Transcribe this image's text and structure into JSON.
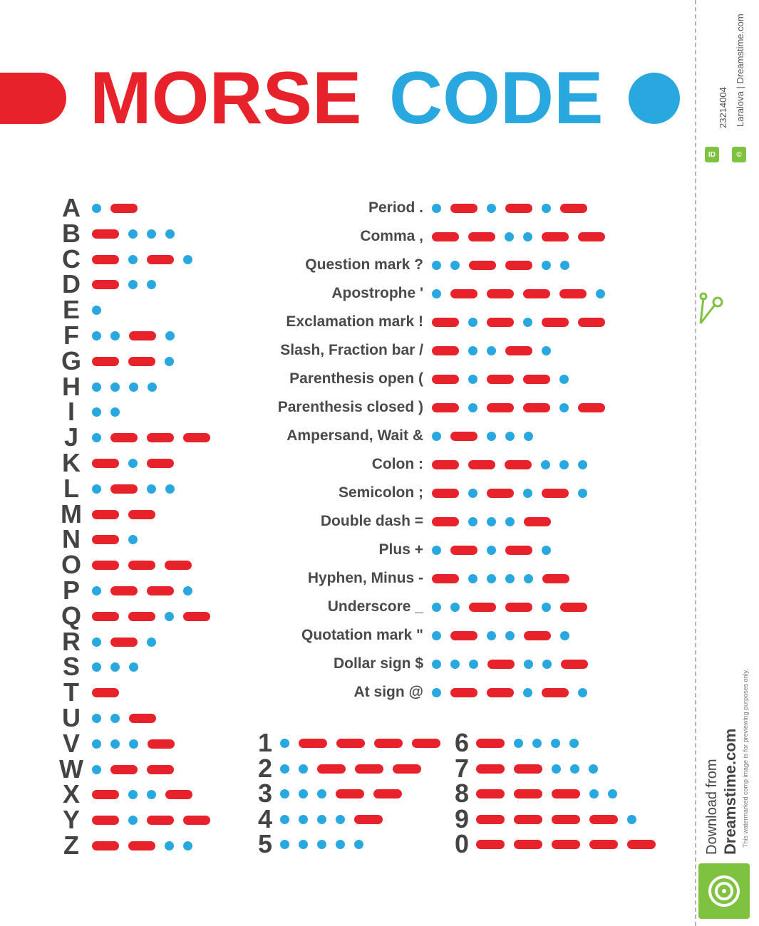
{
  "title": {
    "word1": "MORSE",
    "word2": "CODE"
  },
  "colors": {
    "dot": "#29a8df",
    "dash": "#e8222b",
    "text": "#444444"
  },
  "letters": [
    {
      "char": "A",
      "code": ".-"
    },
    {
      "char": "B",
      "code": "-..."
    },
    {
      "char": "C",
      "code": "-.-."
    },
    {
      "char": "D",
      "code": "-.."
    },
    {
      "char": "E",
      "code": "."
    },
    {
      "char": "F",
      "code": "..-."
    },
    {
      "char": "G",
      "code": "--."
    },
    {
      "char": "H",
      "code": "...."
    },
    {
      "char": "I",
      "code": ".."
    },
    {
      "char": "J",
      "code": ".---"
    },
    {
      "char": "K",
      "code": "-.-"
    },
    {
      "char": "L",
      "code": ".-.."
    },
    {
      "char": "M",
      "code": "--"
    },
    {
      "char": "N",
      "code": "-."
    },
    {
      "char": "O",
      "code": "---"
    },
    {
      "char": "P",
      "code": ".--."
    },
    {
      "char": "Q",
      "code": "--.-"
    },
    {
      "char": "R",
      "code": ".-."
    },
    {
      "char": "S",
      "code": "..."
    },
    {
      "char": "T",
      "code": "-"
    },
    {
      "char": "U",
      "code": "..-"
    },
    {
      "char": "V",
      "code": "...-"
    },
    {
      "char": "W",
      "code": ".--"
    },
    {
      "char": "X",
      "code": "-..-"
    },
    {
      "char": "Y",
      "code": "-.--"
    },
    {
      "char": "Z",
      "code": "--.."
    }
  ],
  "punctuation": [
    {
      "label": "Period .",
      "code": ".-.-.-"
    },
    {
      "label": "Comma ,",
      "code": "--..--"
    },
    {
      "label": "Question mark ?",
      "code": "..--.."
    },
    {
      "label": "Apostrophe '",
      "code": ".----."
    },
    {
      "label": "Exclamation mark !",
      "code": "-.-.--"
    },
    {
      "label": "Slash, Fraction bar /",
      "code": "-..-."
    },
    {
      "label": "Parenthesis open (",
      "code": "-.--."
    },
    {
      "label": "Parenthesis closed )",
      "code": "-.--.-"
    },
    {
      "label": "Ampersand, Wait &",
      "code": ".-..."
    },
    {
      "label": "Colon :",
      "code": "---..."
    },
    {
      "label": "Semicolon ;",
      "code": "-.-.-."
    },
    {
      "label": "Double dash =",
      "code": "-...-"
    },
    {
      "label": "Plus +",
      "code": ".-.-."
    },
    {
      "label": "Hyphen, Minus -",
      "code": "-....-"
    },
    {
      "label": "Underscore _",
      "code": "..--.-"
    },
    {
      "label": "Quotation mark \"",
      "code": ".-..-."
    },
    {
      "label": "Dollar sign $",
      "code": "...-..-"
    },
    {
      "label": "At sign @",
      "code": ".--.-."
    }
  ],
  "digits_left": [
    {
      "char": "1",
      "code": ".----"
    },
    {
      "char": "2",
      "code": "..---"
    },
    {
      "char": "3",
      "code": "...--"
    },
    {
      "char": "4",
      "code": "....-"
    },
    {
      "char": "5",
      "code": "....."
    }
  ],
  "digits_right": [
    {
      "char": "6",
      "code": "-...."
    },
    {
      "char": "7",
      "code": "--..."
    },
    {
      "char": "8",
      "code": "---.."
    },
    {
      "char": "9",
      "code": "----."
    },
    {
      "char": "0",
      "code": "-----"
    }
  ],
  "sidebar": {
    "id_badge": "ID",
    "id_number": "23214004",
    "copyright_badge": "©",
    "credit": "Laralova | Dreamstime.com",
    "notice": "This watermarked comp image is for previewing purposes only.",
    "download_line1": "Download from",
    "download_line2": "Dreamstime.com",
    "scissors_icon": "scissors-icon",
    "logo_icon": "dreamstime-swirl-icon"
  }
}
